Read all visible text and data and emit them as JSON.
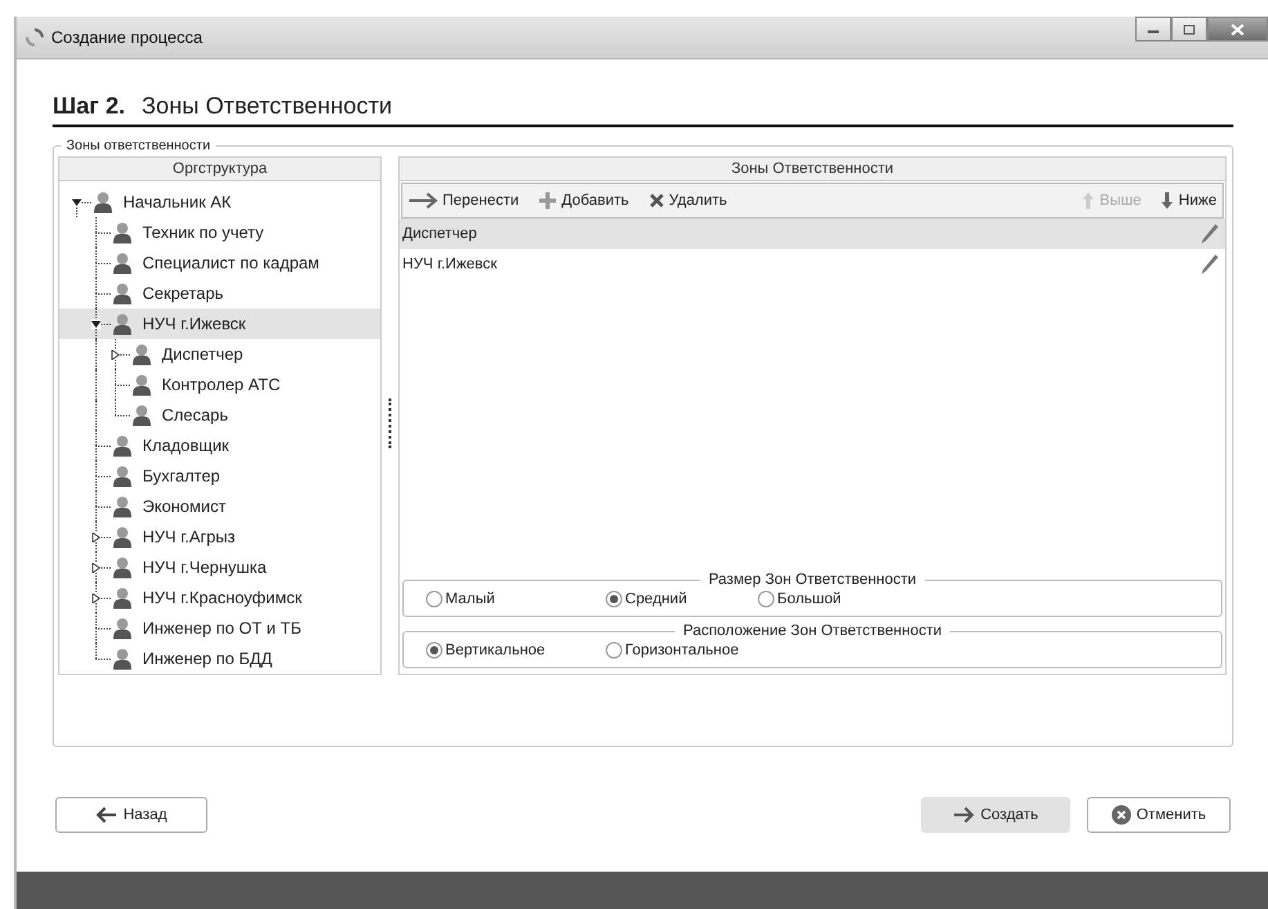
{
  "window": {
    "title": "Создание процесса"
  },
  "step": {
    "number": "Шаг 2.",
    "title": "Зоны Ответственности"
  },
  "group": {
    "title": "Зоны ответственности"
  },
  "tree": {
    "header": "Оргструктура",
    "nodes": [
      {
        "label": "Начальник АК",
        "selected": false,
        "expanded": true,
        "children": [
          {
            "label": "Техник  по учету",
            "selected": false
          },
          {
            "label": "Специалист по кадрам",
            "selected": false
          },
          {
            "label": "Секретарь",
            "selected": false
          },
          {
            "label": "НУЧ  г.Ижевск",
            "selected": true,
            "expanded": true,
            "children": [
              {
                "label": "Диспетчер",
                "selected": false,
                "expanded": false
              },
              {
                "label": "Контролер  АТС",
                "selected": false
              },
              {
                "label": "Слесарь",
                "selected": false
              }
            ]
          },
          {
            "label": "Кладовщик",
            "selected": false
          },
          {
            "label": "Бухгалтер",
            "selected": false
          },
          {
            "label": "Экономист",
            "selected": false
          },
          {
            "label": "НУЧ г.Агрыз",
            "selected": false,
            "expanded": false
          },
          {
            "label": "НУЧ г.Чернушка",
            "selected": false,
            "expanded": false
          },
          {
            "label": "НУЧ г.Красноуфимск",
            "selected": false,
            "expanded": false
          },
          {
            "label": "Инженер  по ОТ и ТБ",
            "selected": false
          },
          {
            "label": "Инженер  по БДД",
            "selected": false
          }
        ]
      }
    ]
  },
  "zones": {
    "header": "Зоны Ответственности",
    "left_tools": [
      {
        "kind": "move",
        "label": "Перенести",
        "disabled": false
      },
      {
        "kind": "add",
        "label": "Добавить",
        "disabled": false
      },
      {
        "kind": "delete",
        "label": "Удалить",
        "disabled": false
      }
    ],
    "right_tools": [
      {
        "kind": "up",
        "label": "Выше",
        "disabled": true
      },
      {
        "kind": "down",
        "label": "Ниже",
        "disabled": false
      }
    ],
    "rows": [
      {
        "label": "Диспетчер",
        "selected": true
      },
      {
        "label": "НУЧ  г.Ижевск",
        "selected": false
      }
    ]
  },
  "radio_groups": [
    {
      "title": "Размер Зон Ответственности",
      "options": [
        {
          "label": "Малый",
          "selected": false
        },
        {
          "label": "Средний",
          "selected": true
        },
        {
          "label": "Большой",
          "selected": false
        }
      ]
    },
    {
      "title": "Расположение Зон Ответственности",
      "options": [
        {
          "label": "Вертикальное",
          "selected": true
        },
        {
          "label": "Горизонтальное",
          "selected": false
        }
      ]
    }
  ],
  "footer": {
    "left": [
      {
        "kind": "back",
        "label": "Назад"
      }
    ],
    "right": [
      {
        "kind": "create",
        "label": "Создать"
      },
      {
        "kind": "cancel",
        "label": "Отменить"
      }
    ]
  }
}
